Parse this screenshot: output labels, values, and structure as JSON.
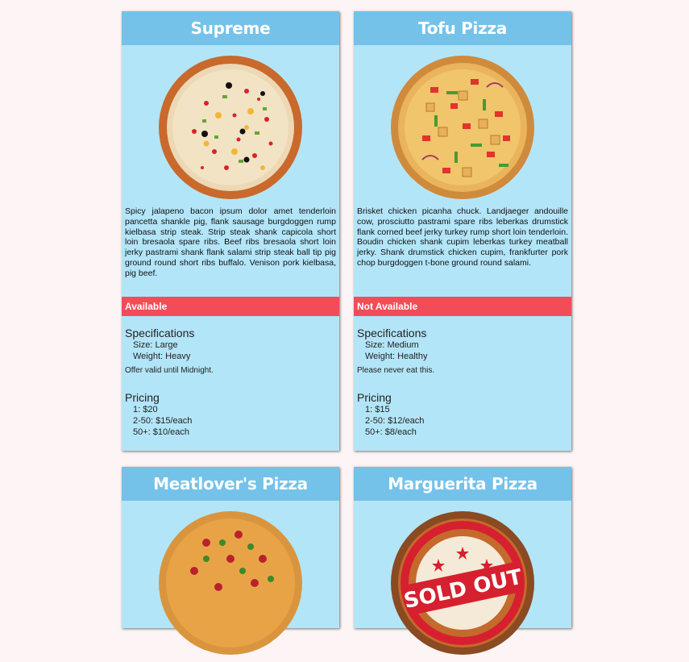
{
  "cards": [
    {
      "title": "Supreme",
      "description": "Spicy jalapeno bacon ipsum dolor amet tenderloin pancetta shankle pig, flank sausage burgdoggen rump kielbasa strip steak. Strip steak shank capicola short loin bresaola spare ribs. Beef ribs bresaola short loin jerky pastrami shank flank salami strip steak ball tip pig ground round short ribs buffalo. Venison pork kielbasa, pig beef.",
      "status": "Available",
      "specs_heading": "Specifications",
      "size": "Size: Large",
      "weight": "Weight: Heavy",
      "note": "Offer valid until Midnight.",
      "pricing_heading": "Pricing",
      "prices": [
        "1: $20",
        "2-50: $15/each",
        "50+: $10/each"
      ]
    },
    {
      "title": "Tofu Pizza",
      "description": "Brisket chicken picanha chuck. Landjaeger andouille cow, prosciutto pastrami spare ribs leberkas drumstick flank corned beef jerky turkey rump short loin tenderloin. Boudin chicken shank cupim leberkas turkey meatball jerky. Shank drumstick chicken cupim, frankfurter pork chop burgdoggen t-bone ground round salami.",
      "status": "Not Available",
      "specs_heading": "Specifications",
      "size": "Size: Medium",
      "weight": "Weight: Healthy",
      "note": "Please never eat this.",
      "pricing_heading": "Pricing",
      "prices": [
        "1: $15",
        "2-50: $12/each",
        "50+: $8/each"
      ]
    },
    {
      "title": "Meatlover's Pizza"
    },
    {
      "title": "Marguerita Pizza",
      "stamp": "SOLD OUT"
    }
  ],
  "icons": {
    "supreme": "pizza-supreme-image",
    "tofu": "pizza-tofu-image",
    "meat": "pizza-meatlover-image",
    "marguerita": "pizza-sold-out-image"
  },
  "colors": {
    "header": "#74c2ea",
    "card": "#b3e5f8",
    "status": "#f34c59",
    "stamp": "#d6202f"
  }
}
